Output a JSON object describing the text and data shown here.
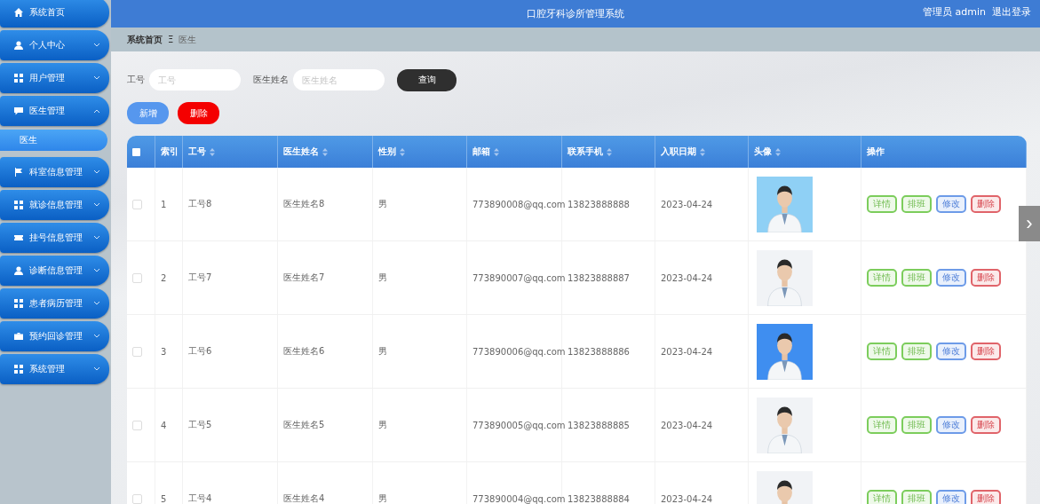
{
  "sidebar": {
    "items": [
      {
        "label": "系统首页"
      },
      {
        "label": "个人中心",
        "expanded": false
      },
      {
        "label": "用户管理",
        "expanded": false
      },
      {
        "label": "医生管理",
        "expanded": true,
        "children": [
          {
            "label": "医生",
            "selected": true
          }
        ]
      },
      {
        "label": "科室信息管理",
        "expanded": false
      },
      {
        "label": "就诊信息管理",
        "expanded": false
      },
      {
        "label": "挂号信息管理",
        "expanded": false
      },
      {
        "label": "诊断信息管理",
        "expanded": false
      },
      {
        "label": "患者病历管理",
        "expanded": false
      },
      {
        "label": "预约回诊管理",
        "expanded": false
      },
      {
        "label": "系统管理",
        "expanded": false
      }
    ]
  },
  "header": {
    "title": "口腔牙科诊所管理系统",
    "user": "管理员 admin",
    "logout": "退出登录"
  },
  "breadcrumb": {
    "items": [
      "系统首页",
      "医生"
    ],
    "separator": "Ξ"
  },
  "search": {
    "fields": [
      {
        "label": "工号",
        "placeholder": "工号"
      },
      {
        "label": "医生姓名",
        "placeholder": "医生姓名"
      }
    ],
    "button": "查询"
  },
  "actions": [
    {
      "label": "新增",
      "kind": "add"
    },
    {
      "label": "删除",
      "kind": "delete"
    }
  ],
  "table": {
    "select_all": {
      "checked": false
    },
    "columns": [
      {
        "label": "索引",
        "sortable": false
      },
      {
        "label": "工号",
        "sortable": true
      },
      {
        "label": "医生姓名",
        "sortable": true
      },
      {
        "label": "性别",
        "sortable": true
      },
      {
        "label": "邮箱",
        "sortable": true
      },
      {
        "label": "联系手机",
        "sortable": true
      },
      {
        "label": "入职日期",
        "sortable": true
      },
      {
        "label": "头像",
        "sortable": true
      },
      {
        "label": "操作",
        "sortable": false
      }
    ],
    "rows": [
      {
        "checked": false,
        "cells": [
          "1",
          "工号8",
          "医生姓名8",
          "男",
          "773890008@qq.com",
          "13823888888",
          "2023-04-24"
        ],
        "photo": {
          "kind": "picture"
        },
        "actions": [
          {
            "label": "详情",
            "kind": "success"
          },
          {
            "label": "排班",
            "kind": "success"
          },
          {
            "label": "修改",
            "kind": "primary"
          },
          {
            "label": "删除",
            "kind": "danger"
          }
        ]
      },
      {
        "checked": false,
        "cells": [
          "2",
          "工号7",
          "医生姓名7",
          "男",
          "773890007@qq.com",
          "13823888887",
          "2023-04-24"
        ],
        "photo": {
          "kind": "picture"
        },
        "actions": [
          {
            "label": "详情",
            "kind": "success"
          },
          {
            "label": "排班",
            "kind": "success"
          },
          {
            "label": "修改",
            "kind": "primary"
          },
          {
            "label": "删除",
            "kind": "danger"
          }
        ]
      },
      {
        "checked": false,
        "cells": [
          "3",
          "工号6",
          "医生姓名6",
          "男",
          "773890006@qq.com",
          "13823888886",
          "2023-04-24"
        ],
        "photo": {
          "kind": "picture"
        },
        "actions": [
          {
            "label": "详情",
            "kind": "success"
          },
          {
            "label": "排班",
            "kind": "success"
          },
          {
            "label": "修改",
            "kind": "primary"
          },
          {
            "label": "删除",
            "kind": "danger"
          }
        ]
      },
      {
        "checked": false,
        "cells": [
          "4",
          "工号5",
          "医生姓名5",
          "男",
          "773890005@qq.com",
          "13823888885",
          "2023-04-24"
        ],
        "photo": {
          "kind": "picture"
        },
        "actions": [
          {
            "label": "详情",
            "kind": "success"
          },
          {
            "label": "排班",
            "kind": "success"
          },
          {
            "label": "修改",
            "kind": "primary"
          },
          {
            "label": "删除",
            "kind": "danger"
          }
        ]
      },
      {
        "checked": false,
        "cells": [
          "5",
          "工号4",
          "医生姓名4",
          "男",
          "773890004@qq.com",
          "13823888884",
          "2023-04-24"
        ],
        "photo": {
          "kind": "picture"
        },
        "actions": [
          {
            "label": "详情",
            "kind": "success"
          },
          {
            "label": "排班",
            "kind": "success"
          },
          {
            "label": "修改",
            "kind": "primary"
          },
          {
            "label": "删除",
            "kind": "danger"
          }
        ]
      }
    ]
  },
  "side_tab": {
    "icon": "›"
  }
}
